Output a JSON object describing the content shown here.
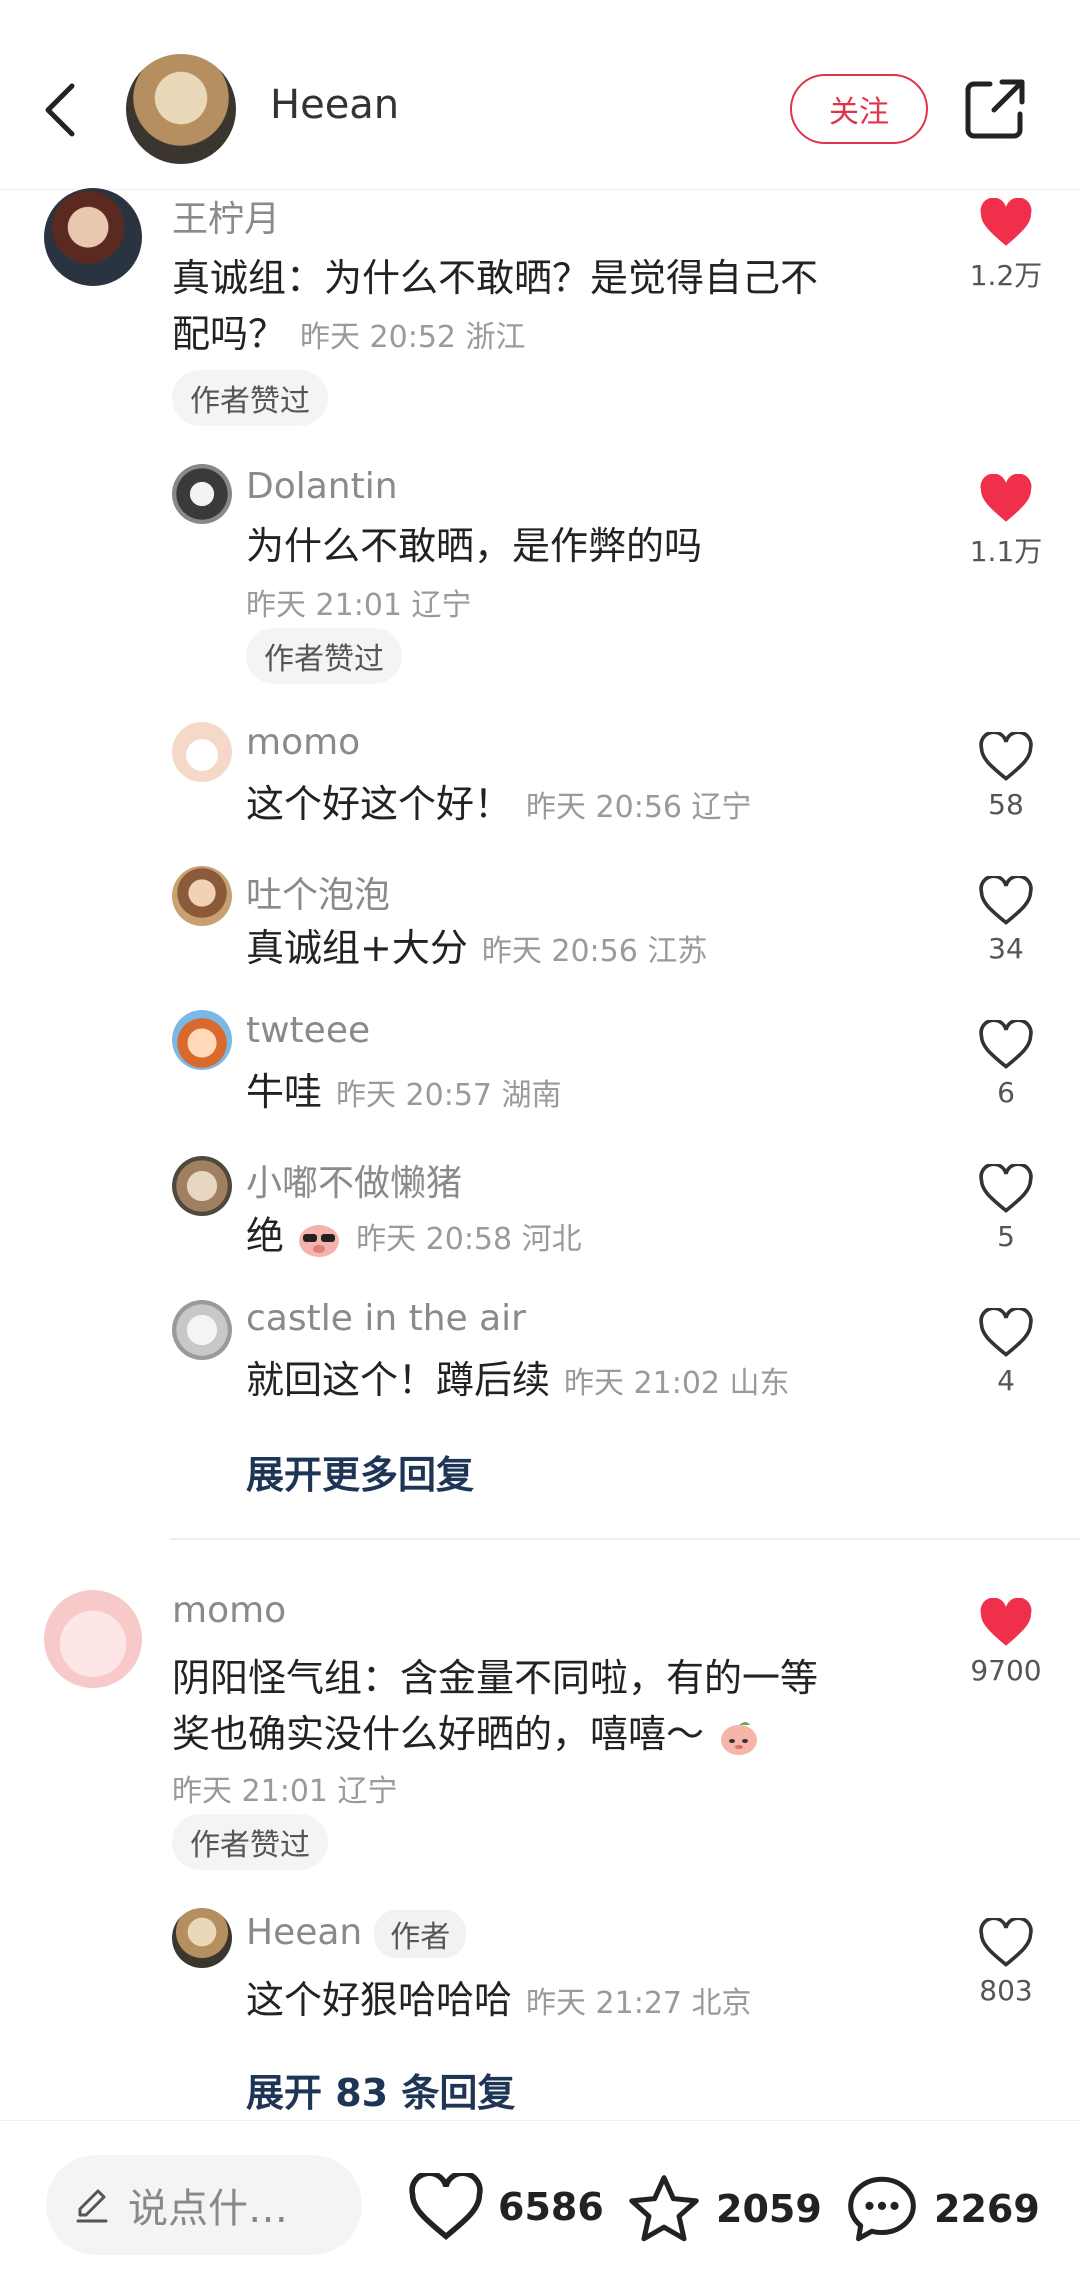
{
  "header": {
    "name": "Heean",
    "follow_label": "关注"
  },
  "comments": [
    {
      "user": "王柠月",
      "text_line1": "真诚组：为什么不敢晒？是觉得自己不",
      "text_line2": "配吗？",
      "time": "昨天 20:52 浙江",
      "tag": "作者赞过",
      "likes": "1.2万",
      "liked": true,
      "replies": [
        {
          "user": "Dolantin",
          "text": "为什么不敢晒，是作弊的吗",
          "time": "昨天 21:01 辽宁",
          "tag": "作者赞过",
          "likes": "1.1万",
          "liked": true
        },
        {
          "user": "momo",
          "text": "这个好这个好！",
          "time": "昨天 20:56 辽宁",
          "likes": "58"
        },
        {
          "user": "吐个泡泡",
          "text": "真诚组+大分",
          "time": "昨天 20:56 江苏",
          "likes": "34"
        },
        {
          "user": "twteee",
          "text": "牛哇",
          "time": "昨天 20:57 湖南",
          "likes": "6"
        },
        {
          "user": "小嘟不做懒猪",
          "text": "绝",
          "time": "昨天 20:58 河北",
          "likes": "5"
        },
        {
          "user": "castle in the air",
          "text": "就回这个！蹲后续",
          "time": "昨天 21:02 山东",
          "likes": "4"
        }
      ],
      "expand_label": "展开更多回复"
    },
    {
      "user": "momo",
      "text_line1": "阴阳怪气组：含金量不同啦，有的一等",
      "text_line2": "奖也确实没什么好晒的，嘻嘻～",
      "time": "昨天 21:01 辽宁",
      "tag": "作者赞过",
      "likes": "9700",
      "liked": true,
      "replies": [
        {
          "user": "Heean",
          "author_tag": "作者",
          "text": "这个好狠哈哈哈",
          "time": "昨天 21:27 北京",
          "likes": "803"
        }
      ],
      "expand_label": "展开 83 条回复"
    }
  ],
  "bottom_bar": {
    "input_placeholder": "说点什…",
    "like_count": "6586",
    "star_count": "2059",
    "comment_count": "2269"
  },
  "colors": {
    "accent": "#e0344b",
    "link": "#1f3556"
  },
  "icons": [
    "back-arrow-icon",
    "share-icon",
    "heart-icon",
    "heart-outline-icon",
    "star-icon",
    "comment-icon",
    "pen-icon"
  ]
}
